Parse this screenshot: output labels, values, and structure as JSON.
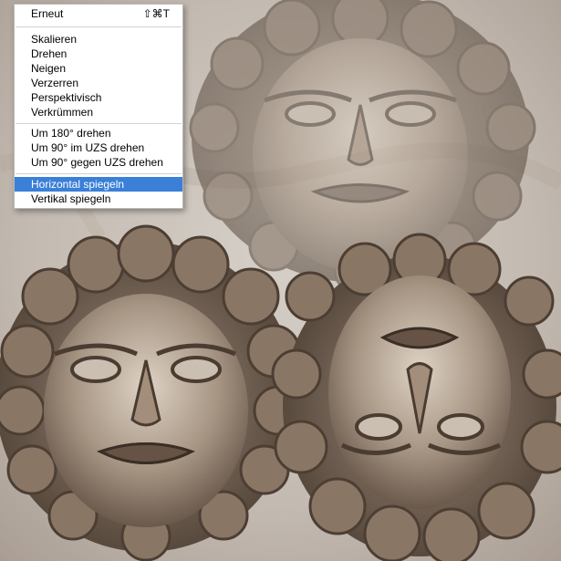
{
  "menu": {
    "repeat": {
      "label": "Erneut",
      "shortcut": "⇧⌘T"
    },
    "group1": [
      "Skalieren",
      "Drehen",
      "Neigen",
      "Verzerren",
      "Perspektivisch",
      "Verkrümmen"
    ],
    "group2": [
      "Um 180° drehen",
      "Um 90° im UZS drehen",
      "Um 90° gegen UZS drehen"
    ],
    "group3": [
      "Horizontal spiegeln",
      "Vertikal spiegeln"
    ],
    "selected_label": "Horizontal spiegeln"
  },
  "colors": {
    "highlight": "#3a7fd8",
    "background_marble": "#c9c1b9",
    "stone": "#8d7a69"
  }
}
